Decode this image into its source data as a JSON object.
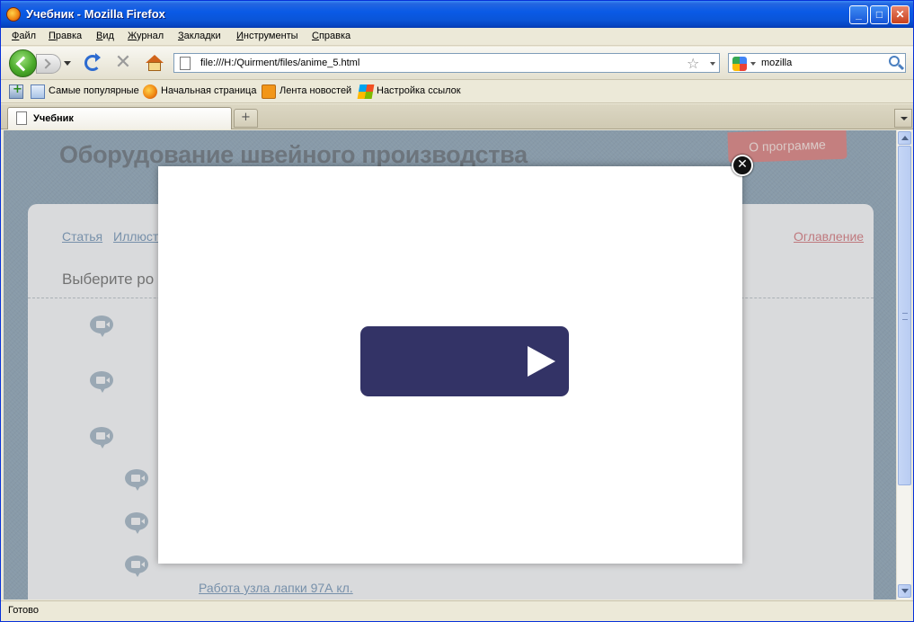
{
  "window": {
    "title": "Учебник - Mozilla Firefox"
  },
  "menu": {
    "items": [
      "Файл",
      "Правка",
      "Вид",
      "Журнал",
      "Закладки",
      "Инструменты",
      "Справка"
    ]
  },
  "navbar": {
    "url": "file:///H:/Quirment/files/anime_5.html",
    "search_value": "mozilla"
  },
  "bookmarks": {
    "items": [
      "Самые популярные",
      "Начальная страница",
      "Лента новостей",
      "Настройка ссылок"
    ]
  },
  "tabs": {
    "active_label": "Учебник",
    "new_tab_symbol": "+"
  },
  "page": {
    "site_title": "Оборудование швейного производства",
    "about_button": "О программе",
    "crumbs": [
      "Статья",
      "Иллюст"
    ],
    "toc_link": "Оглавление",
    "choose_heading": "Выберите ро",
    "item_link": "Работа узла лапки 97А кл."
  },
  "modal": {
    "close_symbol": "✕"
  },
  "status": {
    "text": "Готово"
  }
}
